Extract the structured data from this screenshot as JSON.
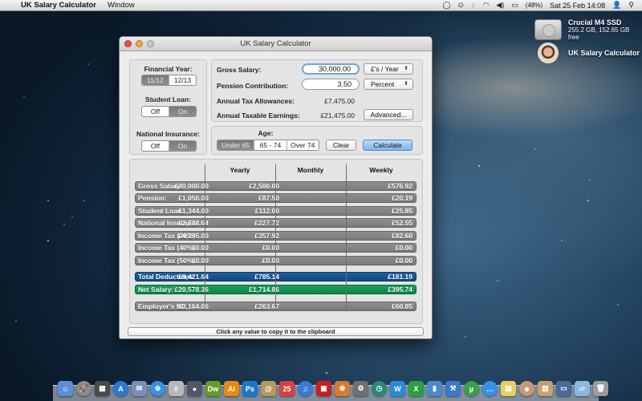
{
  "menubar": {
    "app_name": "UK Salary Calculator",
    "menus": [
      "Window"
    ],
    "battery": "(48%)",
    "datetime": "Sat 25 Feb  14:08"
  },
  "desktop": {
    "drive": {
      "name": "Crucial M4 SSD",
      "info": "255.2 GB, 152.65 GB free"
    },
    "app_icon": {
      "name": "UK Salary Calculator"
    }
  },
  "window": {
    "title": "UK Salary Calculator",
    "financial_year": {
      "label": "Financial Year:",
      "options": [
        "11/12",
        "12/13"
      ],
      "selected": "11/12"
    },
    "student_loan": {
      "label": "Student Loan:",
      "options": [
        "Off",
        "On"
      ],
      "selected": "On"
    },
    "national_insurance": {
      "label": "National Insurance:",
      "options": [
        "Off",
        "On"
      ],
      "selected": "On"
    },
    "gross_salary": {
      "label": "Gross Salary:",
      "value": "30,000.00",
      "unit": "£'s / Year"
    },
    "pension": {
      "label": "Pension Contribution:",
      "value": "3.50",
      "unit": "Percent"
    },
    "tax_allowances": {
      "label": "Annual Tax Allowances:",
      "value": "£7,475.00"
    },
    "taxable_earnings": {
      "label": "Annual Taxable Earnings:",
      "value": "£21,475.00"
    },
    "advanced_label": "Advanced...",
    "age": {
      "label": "Age:",
      "options": [
        "Under 65",
        "65 - 74",
        "Over 74"
      ],
      "selected": "Under 65"
    },
    "clear_label": "Clear",
    "calculate_label": "Calculate",
    "table": {
      "headers": [
        "Yearly",
        "Monthly",
        "Weekly"
      ],
      "rows": [
        {
          "label": "Gross Salary:",
          "yearly": "£30,000.00",
          "monthly": "£2,500.00",
          "weekly": "£576.92"
        },
        {
          "label": "Pension:",
          "yearly": "£1,050.00",
          "monthly": "£87.50",
          "weekly": "£20.19"
        },
        {
          "label": "Student Loan:",
          "yearly": "£1,344.00",
          "monthly": "£112.00",
          "weekly": "£25.85"
        },
        {
          "label": "National Insurance:",
          "yearly": "£2,732.64",
          "monthly": "£227.72",
          "weekly": "£52.55"
        },
        {
          "label": "Income Tax (20%):",
          "yearly": "£4,295.00",
          "monthly": "£357.92",
          "weekly": "£82.60"
        },
        {
          "label": "Income Tax (40%):",
          "yearly": "£0.00",
          "monthly": "£0.00",
          "weekly": "£0.00"
        },
        {
          "label": "Income Tax (50%):",
          "yearly": "£0.00",
          "monthly": "£0.00",
          "weekly": "£0.00"
        },
        {
          "label": "Total Deductions:",
          "yearly": "£9,421.64",
          "monthly": "£785.14",
          "weekly": "£181.19"
        },
        {
          "label": "Net Salary:",
          "yearly": "£20,578.36",
          "monthly": "£1,714.86",
          "weekly": "£395.74"
        },
        {
          "label": "Employer's NI:",
          "yearly": "£3,164.06",
          "monthly": "£263.67",
          "weekly": "£60.85"
        }
      ]
    },
    "status": "Click any value to copy it to the clipboard"
  },
  "colors": {
    "total_deductions": "#124a85",
    "net_salary": "#0b8748",
    "row_gray": "#808080",
    "default_button": "#7db6ea"
  },
  "dock": {
    "apps": [
      {
        "name": "finder",
        "glyph": "☺",
        "color": "#5a8fd6"
      },
      {
        "name": "launchpad",
        "glyph": "🚀",
        "color": "#8a8a8a"
      },
      {
        "name": "mission-control",
        "glyph": "▦",
        "color": "#4a4a4a"
      },
      {
        "name": "app-store",
        "glyph": "A",
        "color": "#2a78d8"
      },
      {
        "name": "mail",
        "glyph": "✉",
        "color": "#7a8fb8"
      },
      {
        "name": "safari",
        "glyph": "⊕",
        "color": "#3a90e0"
      },
      {
        "name": "calculator",
        "glyph": "#",
        "color": "#b8b8b8"
      },
      {
        "name": "facetime",
        "glyph": "●",
        "color": "#556"
      },
      {
        "name": "dreamweaver",
        "glyph": "Dw",
        "color": "#6a9a20"
      },
      {
        "name": "illustrator",
        "glyph": "Ai",
        "color": "#e88a10"
      },
      {
        "name": "photoshop",
        "glyph": "Ps",
        "color": "#1a78c8"
      },
      {
        "name": "contacts",
        "glyph": "@",
        "color": "#b89860"
      },
      {
        "name": "calendar",
        "glyph": "25",
        "color": "#d84040"
      },
      {
        "name": "itunes",
        "glyph": "♫",
        "color": "#3a7ad8"
      },
      {
        "name": "photo-booth",
        "glyph": "▣",
        "color": "#c82020"
      },
      {
        "name": "iphoto",
        "glyph": "❀",
        "color": "#d87a30"
      },
      {
        "name": "system-preferences",
        "glyph": "⚙",
        "color": "#707070"
      },
      {
        "name": "time-machine",
        "glyph": "◷",
        "color": "#2a8a7a"
      },
      {
        "name": "word",
        "glyph": "W",
        "color": "#2a8ad8"
      },
      {
        "name": "excel",
        "glyph": "X",
        "color": "#2aa040"
      },
      {
        "name": "numbers",
        "glyph": "▮",
        "color": "#4a8ad0"
      },
      {
        "name": "xcode",
        "glyph": "⚒",
        "color": "#3a78c8"
      },
      {
        "name": "utorrent",
        "glyph": "µ",
        "color": "#3aa048"
      },
      {
        "name": "messages",
        "glyph": "…",
        "color": "#3a90e8"
      },
      {
        "name": "stickies",
        "glyph": "▤",
        "color": "#e8d060"
      },
      {
        "name": "uk-salary-calculator",
        "glyph": "☻",
        "color": "#c89878"
      },
      {
        "name": "applications-folder",
        "glyph": "▥",
        "color": "#c8a070"
      },
      {
        "name": "documents",
        "glyph": "▭",
        "color": "#4a6a9a"
      },
      {
        "name": "downloads",
        "glyph": "▱",
        "color": "#8ab8e0"
      },
      {
        "name": "trash",
        "glyph": "🗑",
        "color": "#9a9a9a"
      }
    ]
  }
}
